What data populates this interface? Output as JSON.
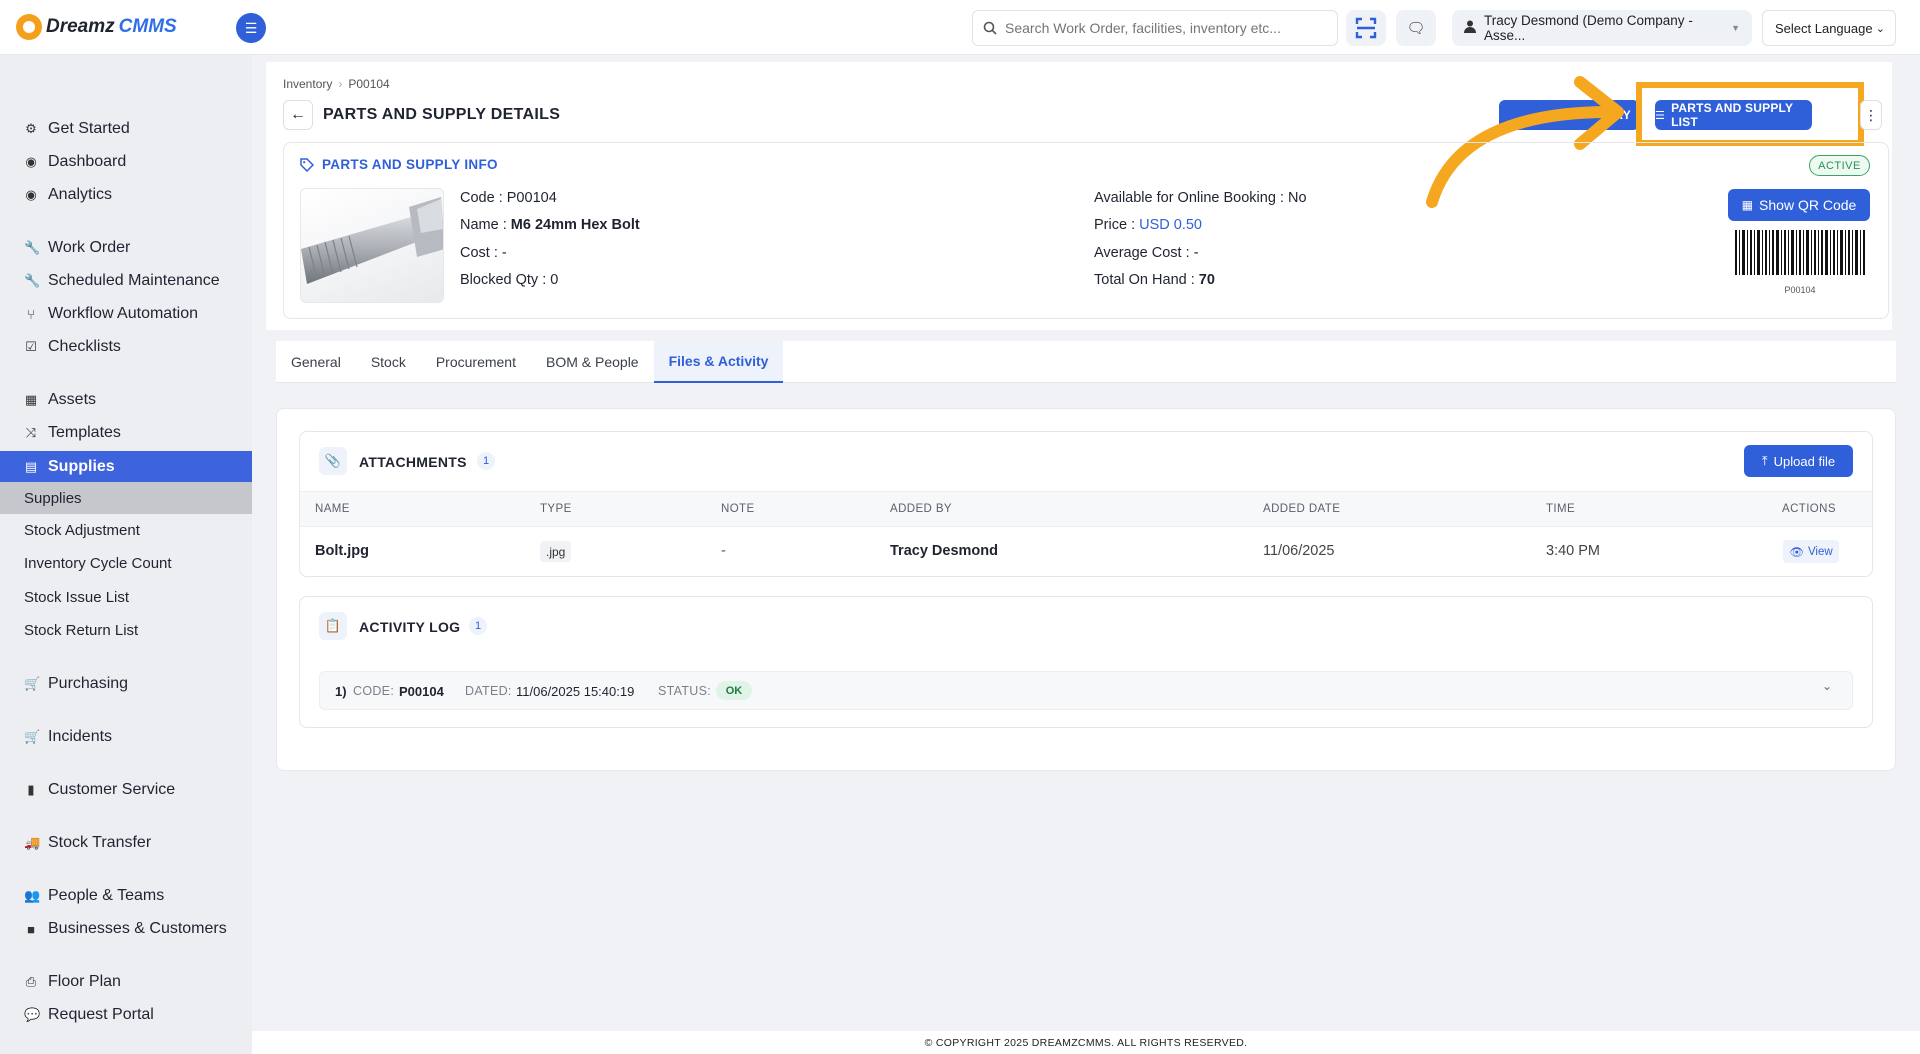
{
  "brand": {
    "name_part1": "Dreamz",
    "name_part2": "CMMS"
  },
  "topbar": {
    "search_placeholder": "Search Work Order, facilities, inventory etc...",
    "user_label": "Tracy Desmond (Demo Company - Asse...",
    "language_label": "Select Language"
  },
  "sidebar": {
    "items": [
      {
        "label": "Get Started",
        "icon": "gears-icon"
      },
      {
        "label": "Dashboard",
        "icon": "dashboard-icon"
      },
      {
        "label": "Analytics",
        "icon": "analytics-icon"
      },
      {
        "label": "Work Order",
        "icon": "wrench-icon"
      },
      {
        "label": "Scheduled Maintenance",
        "icon": "wrench-icon"
      },
      {
        "label": "Workflow Automation",
        "icon": "workflow-icon"
      },
      {
        "label": "Checklists",
        "icon": "checkbox-icon"
      },
      {
        "label": "Assets",
        "icon": "archive-icon"
      },
      {
        "label": "Templates",
        "icon": "shuffle-icon"
      },
      {
        "label": "Supplies",
        "icon": "supplies-icon"
      },
      {
        "label": "Purchasing",
        "icon": "cart-icon"
      },
      {
        "label": "Incidents",
        "icon": "cart-icon"
      },
      {
        "label": "Customer Service",
        "icon": "file-icon"
      },
      {
        "label": "Stock Transfer",
        "icon": "truck-icon"
      },
      {
        "label": "People & Teams",
        "icon": "users-icon"
      },
      {
        "label": "Businesses & Customers",
        "icon": "video-icon"
      },
      {
        "label": "Floor Plan",
        "icon": "print-icon"
      },
      {
        "label": "Request Portal",
        "icon": "chat-icon"
      }
    ],
    "sub_items": [
      "Supplies",
      "Stock Adjustment",
      "Inventory Cycle Count",
      "Stock Issue List",
      "Stock Return List"
    ]
  },
  "breadcrumb": {
    "parent": "Inventory",
    "separator": "›",
    "current": "P00104"
  },
  "page": {
    "title": "PARTS AND SUPPLY DETAILS",
    "btn_hidden_label": "ORY",
    "btn_list_label": "PARTS AND SUPPLY LIST"
  },
  "info": {
    "section_title": "PARTS AND SUPPLY INFO",
    "code_label": "Code :",
    "code_value": "P00104",
    "name_label": "Name :",
    "name_value": "M6 24mm Hex Bolt",
    "cost_label": "Cost :",
    "cost_value": "-",
    "blocked_label": "Blocked Qty :",
    "blocked_value": "0",
    "online_label": "Available for Online Booking :",
    "online_value": "No",
    "price_label": "Price :",
    "price_value": "USD 0.50",
    "avg_cost_label": "Average Cost :",
    "avg_cost_value": "-",
    "on_hand_label": "Total On Hand :",
    "on_hand_value": "70",
    "status": "ACTIVE",
    "qr_button": "Show QR Code",
    "barcode_label": "P00104"
  },
  "tabs": [
    "General",
    "Stock",
    "Procurement",
    "BOM & People",
    "Files & Activity"
  ],
  "attachments": {
    "title": "ATTACHMENTS",
    "count": "1",
    "upload_label": "Upload file",
    "columns": [
      "NAME",
      "TYPE",
      "NOTE",
      "ADDED BY",
      "ADDED DATE",
      "TIME",
      "ACTIONS"
    ],
    "rows": [
      {
        "name": "Bolt.jpg",
        "type": ".jpg",
        "note": "-",
        "added_by": "Tracy Desmond",
        "added_date": "11/06/2025",
        "time": "3:40 PM",
        "action": "View"
      }
    ]
  },
  "activity": {
    "title": "ACTIVITY LOG",
    "count": "1",
    "entries": [
      {
        "index": "1)",
        "code_label": "CODE:",
        "code": "P00104",
        "dated_label": "DATED:",
        "dated": "11/06/2025 15:40:19",
        "status_label": "STATUS:",
        "status": "OK"
      }
    ]
  },
  "footer": "© COPYRIGHT 2025 DREAMZCMMS. ALL RIGHTS RESERVED.",
  "colors": {
    "primary": "#2f5fd9",
    "highlight": "#f5a81f",
    "success": "#3aa364"
  }
}
